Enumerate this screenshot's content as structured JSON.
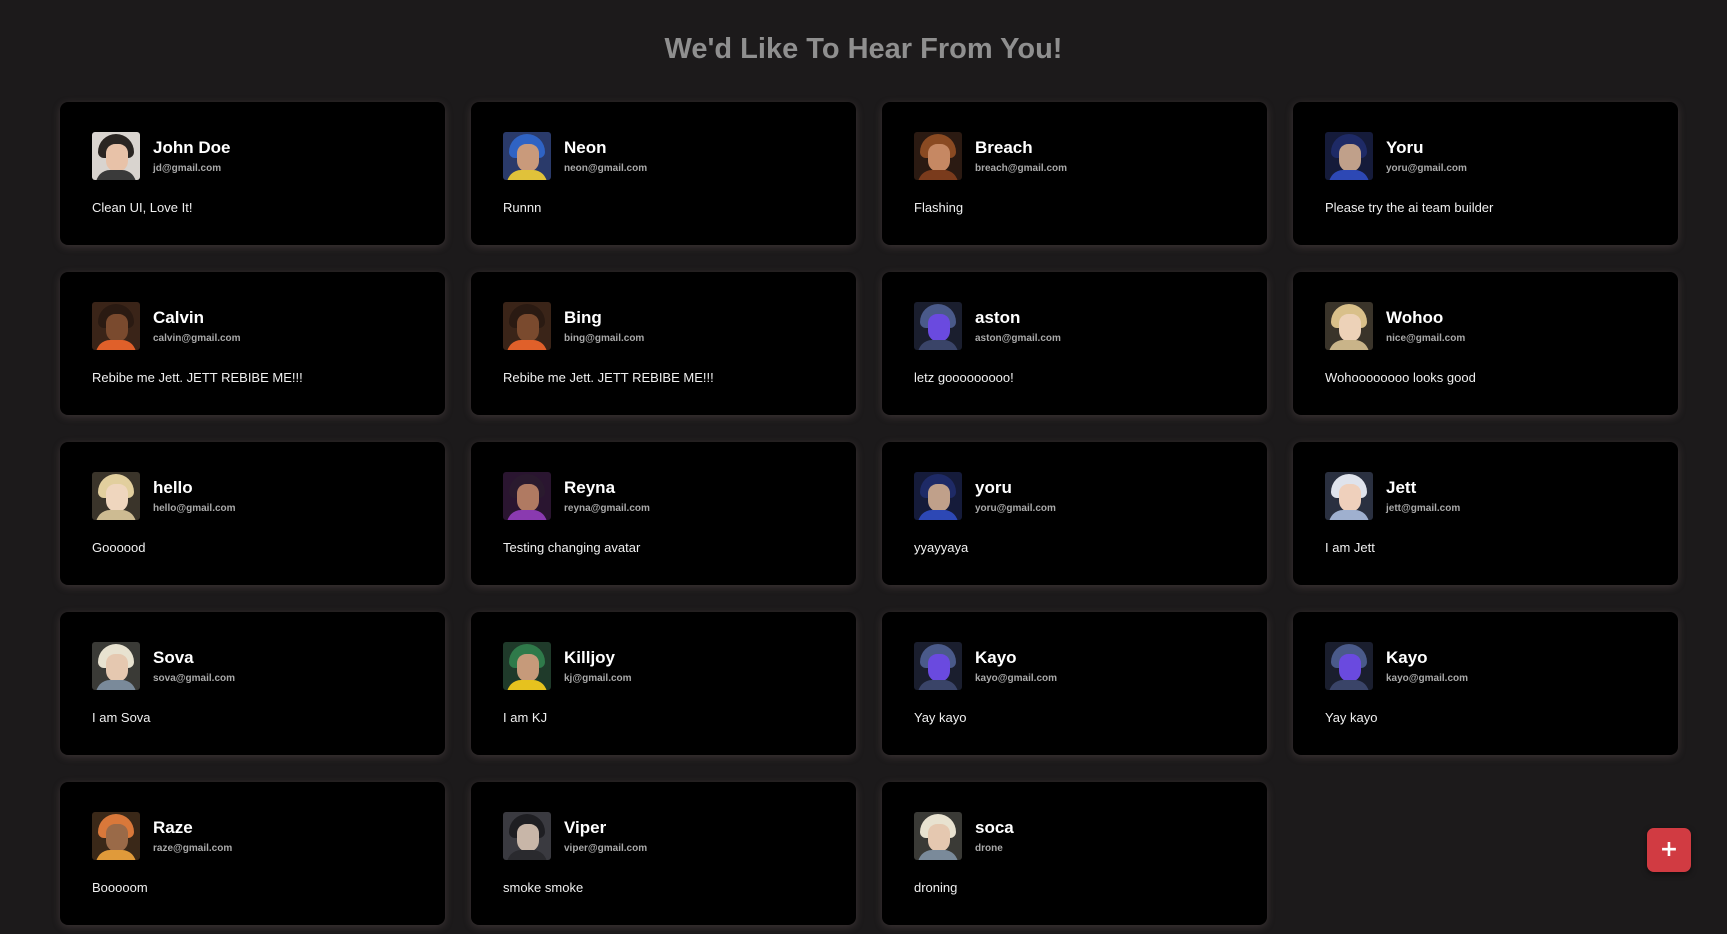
{
  "page": {
    "title": "We'd Like To Hear From You!"
  },
  "colors": {
    "background": "#1c1a1b",
    "card": "#000000",
    "accent": "#d13b42",
    "title": "#8f8f8f"
  },
  "feedback": [
    {
      "name": "John Doe",
      "email": "jd@gmail.com",
      "message": "Clean UI, Love It!",
      "avatar": {
        "icon": "female-agent-avatar",
        "hair": "#2a2522",
        "face": "#e8c2a8",
        "body": "#3a3a3a",
        "bg": "#d9d4cf"
      }
    },
    {
      "name": "Neon",
      "email": "neon@gmail.com",
      "message": "Runnn",
      "avatar": {
        "icon": "neon-avatar",
        "hair": "#2f63c4",
        "face": "#c99a7b",
        "body": "#e0c23a",
        "bg": "#2a3a6a"
      }
    },
    {
      "name": "Breach",
      "email": "breach@gmail.com",
      "message": "Flashing",
      "avatar": {
        "icon": "breach-avatar",
        "hair": "#8a4a22",
        "face": "#c68863",
        "body": "#7a3b1c",
        "bg": "#2b1a12"
      }
    },
    {
      "name": "Yoru",
      "email": "yoru@gmail.com",
      "message": "Please try the ai team builder",
      "avatar": {
        "icon": "yoru-avatar",
        "hair": "#1e2a66",
        "face": "#c0a08a",
        "body": "#2d48b5",
        "bg": "#151b3a"
      }
    },
    {
      "name": "Calvin",
      "email": "calvin@gmail.com",
      "message": "Rebibe me Jett. JETT REBIBE ME!!!",
      "avatar": {
        "icon": "phoenix-avatar",
        "hair": "#2a1a12",
        "face": "#7a4a2e",
        "body": "#e0602a",
        "bg": "#3a2418"
      }
    },
    {
      "name": "Bing",
      "email": "bing@gmail.com",
      "message": "Rebibe me Jett. JETT REBIBE ME!!!",
      "avatar": {
        "icon": "phoenix-avatar",
        "hair": "#2a1a12",
        "face": "#7a4a2e",
        "body": "#e0602a",
        "bg": "#3a2418"
      }
    },
    {
      "name": "aston",
      "email": "aston@gmail.com",
      "message": "letz gooooooooo!",
      "avatar": {
        "icon": "kayo-robot-avatar",
        "hair": "#4a5a8a",
        "face": "#6a4adf",
        "body": "#3a4468",
        "bg": "#1a1e2e"
      }
    },
    {
      "name": "Wohoo",
      "email": "nice@gmail.com",
      "message": "Wohoooooooo looks good",
      "avatar": {
        "icon": "blonde-agent-avatar",
        "hair": "#d9c08a",
        "face": "#edd2b8",
        "body": "#c9b489",
        "bg": "#3a342a"
      }
    },
    {
      "name": "hello",
      "email": "hello@gmail.com",
      "message": "Goooood",
      "avatar": {
        "icon": "blonde-agent-avatar",
        "hair": "#e2cf9e",
        "face": "#efd6be",
        "body": "#cdbb92",
        "bg": "#3a342a"
      }
    },
    {
      "name": "Reyna",
      "email": "reyna@gmail.com",
      "message": "Testing changing avatar",
      "avatar": {
        "icon": "reyna-avatar",
        "hair": "#2a1a2e",
        "face": "#b07a62",
        "body": "#8a3ab0",
        "bg": "#2a1530"
      }
    },
    {
      "name": "yoru",
      "email": "yoru@gmail.com",
      "message": "yyayyaya",
      "avatar": {
        "icon": "yoru-avatar",
        "hair": "#1e2a66",
        "face": "#c0a08a",
        "body": "#2d48b5",
        "bg": "#151b3a"
      }
    },
    {
      "name": "Jett",
      "email": "jett@gmail.com",
      "message": "I am Jett",
      "avatar": {
        "icon": "jett-avatar",
        "hair": "#dfe3ec",
        "face": "#efd0bc",
        "body": "#9fb0cf",
        "bg": "#2a3040"
      }
    },
    {
      "name": "Sova",
      "email": "sova@gmail.com",
      "message": "I am Sova",
      "avatar": {
        "icon": "sova-avatar",
        "hair": "#e8e2d0",
        "face": "#e5c8b0",
        "body": "#7a8a9a",
        "bg": "#3a3a36"
      }
    },
    {
      "name": "Killjoy",
      "email": "kj@gmail.com",
      "message": "I am KJ",
      "avatar": {
        "icon": "killjoy-avatar",
        "hair": "#2f7a4a",
        "face": "#c69a7a",
        "body": "#e6c21e",
        "bg": "#1f3a2a"
      }
    },
    {
      "name": "Kayo",
      "email": "kayo@gmail.com",
      "message": "Yay kayo",
      "avatar": {
        "icon": "kayo-robot-avatar",
        "hair": "#4a5a8a",
        "face": "#6a4adf",
        "body": "#3a4468",
        "bg": "#1a1e2e"
      }
    },
    {
      "name": "Kayo",
      "email": "kayo@gmail.com",
      "message": "Yay kayo",
      "avatar": {
        "icon": "kayo-robot-avatar",
        "hair": "#4a5a8a",
        "face": "#6a4adf",
        "body": "#3a4468",
        "bg": "#1a1e2e"
      }
    },
    {
      "name": "Raze",
      "email": "raze@gmail.com",
      "message": "Booooom",
      "avatar": {
        "icon": "raze-avatar",
        "hair": "#d9783a",
        "face": "#9a6a48",
        "body": "#e09a3a",
        "bg": "#3a2818"
      }
    },
    {
      "name": "Viper",
      "email": "viper@gmail.com",
      "message": "smoke smoke",
      "avatar": {
        "icon": "viper-avatar",
        "hair": "#1e1e22",
        "face": "#c8b6a8",
        "body": "#2a2a2e",
        "bg": "#3a3a40"
      }
    },
    {
      "name": "soca",
      "email": "drone",
      "message": "droning",
      "avatar": {
        "icon": "sova-avatar",
        "hair": "#e8e2d0",
        "face": "#e5c8b0",
        "body": "#7a8a9a",
        "bg": "#3a3a36"
      }
    }
  ],
  "fab": {
    "label": "+",
    "icon": "plus-icon"
  }
}
